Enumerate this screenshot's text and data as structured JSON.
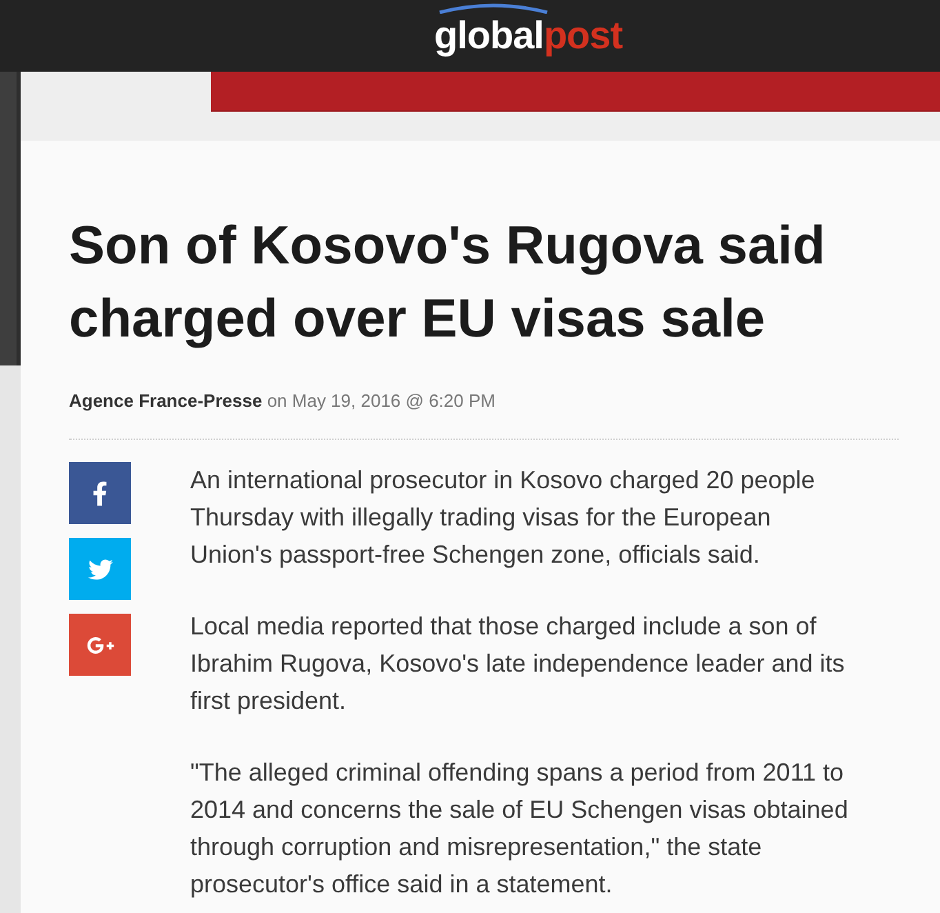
{
  "header": {
    "logo": {
      "main": "global",
      "accent": "post"
    }
  },
  "article": {
    "title": "Son of Kosovo's Rugova said charged over EU visas sale",
    "byline": {
      "author": "Agence France-Presse",
      "date": "on May 19, 2016 @ 6:20 PM"
    },
    "share_buttons": [
      {
        "kind": "facebook",
        "color": "#3a5795"
      },
      {
        "kind": "twitter",
        "color": "#00acee"
      },
      {
        "kind": "googleplus",
        "color": "#dc4a38"
      }
    ],
    "paragraphs": [
      "An international prosecutor in Kosovo charged 20 people Thursday with illegally trading visas for the European Union's passport-free Schengen zone, officials said.",
      "Local media reported that those charged include a son of Ibrahim Rugova, Kosovo's late independence leader and its first president.",
      "\"The alleged criminal offending spans a period from 2011 to 2014 and concerns the sale of EU Schengen visas obtained through corruption and misrepresentation,\" the state prosecutor's office said in a statement."
    ]
  }
}
